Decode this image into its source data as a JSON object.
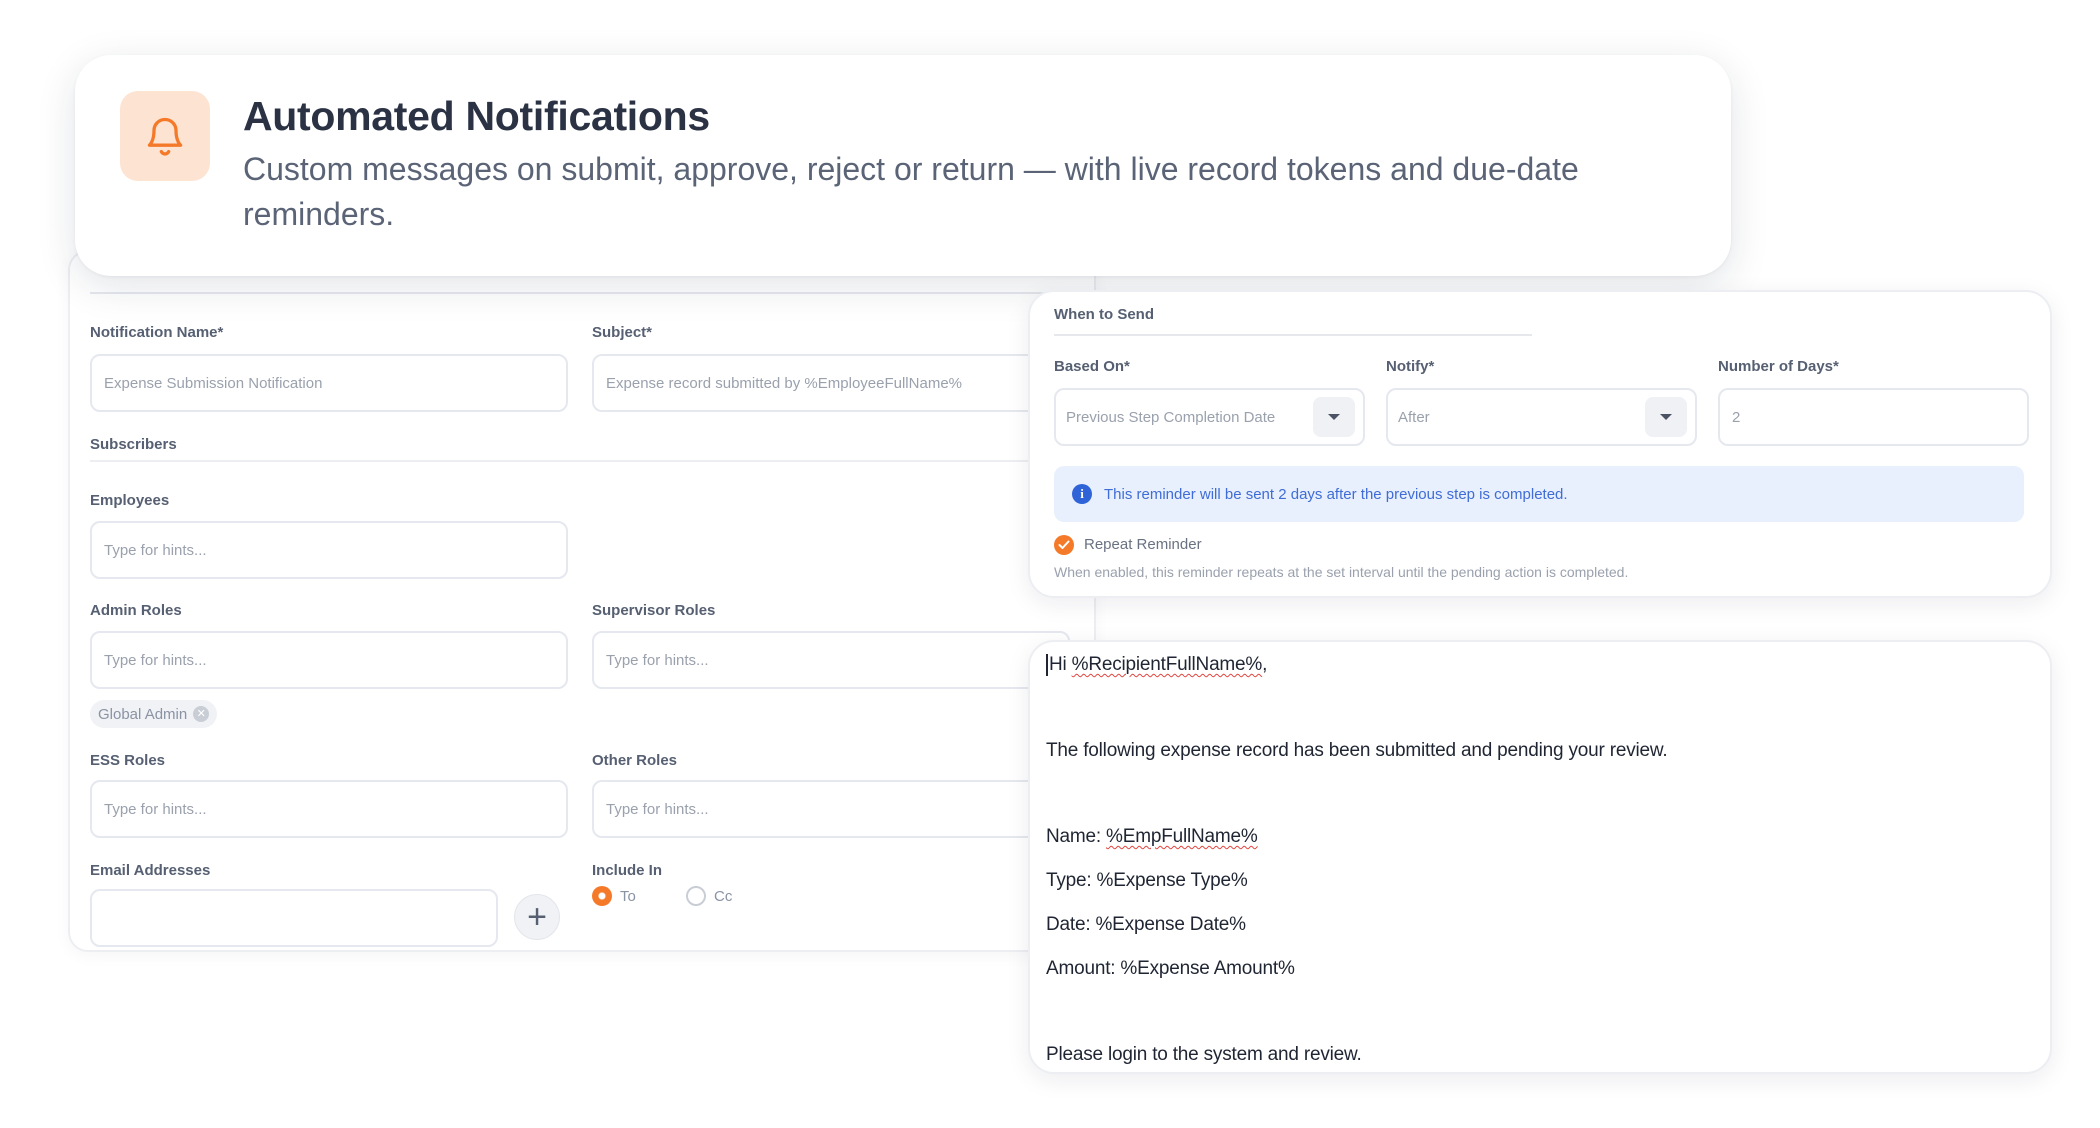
{
  "header": {
    "title": "Automated Notifications",
    "description": "Custom messages on submit, approve, reject or return — with live record tokens and due-date reminders.",
    "icon": "bell-icon",
    "accent_color": "#f47a2a"
  },
  "form": {
    "notification_name": {
      "label": "Notification Name*",
      "value": "Expense Submission Notification"
    },
    "subject": {
      "label": "Subject*",
      "value": "Expense record submitted by %EmployeeFullName%"
    },
    "subscribers_heading": "Subscribers",
    "employees": {
      "label": "Employees",
      "placeholder": "Type for hints..."
    },
    "admin_roles": {
      "label": "Admin Roles",
      "placeholder": "Type for hints...",
      "chips": [
        "Global Admin"
      ]
    },
    "supervisor_roles": {
      "label": "Supervisor Roles",
      "placeholder": "Type for hints..."
    },
    "ess_roles": {
      "label": "ESS Roles",
      "placeholder": "Type for hints..."
    },
    "other_roles": {
      "label": "Other Roles",
      "placeholder": "Type for hints..."
    },
    "email_addresses": {
      "label": "Email Addresses",
      "value": ""
    },
    "include_in": {
      "label": "Include In",
      "options": [
        "To",
        "Cc"
      ],
      "selected": "To"
    }
  },
  "send": {
    "title": "When to Send",
    "based_on": {
      "label": "Based On*",
      "value": "Previous Step Completion Date"
    },
    "notify": {
      "label": "Notify*",
      "value": "After"
    },
    "days": {
      "label": "Number of Days*",
      "value": "2"
    },
    "info": "This reminder will be sent 2 days after the previous step is completed.",
    "repeat": {
      "label": "Repeat Reminder",
      "checked": true,
      "help": "When enabled, this reminder repeats at the set interval until the pending action is completed."
    }
  },
  "message": {
    "greeting_prefix": "Hi ",
    "greeting_token": "%RecipientFullName%",
    "greeting_suffix": ",",
    "line1": "The following expense record has been submitted and pending your review.",
    "name_label": "Name: ",
    "name_token": "%EmpFullName%",
    "type_line": "Type: %Expense Type%",
    "date_line": "Date: %Expense Date%",
    "amount_line": "Amount: %Expense Amount%",
    "closing": "Please login to the system and review."
  }
}
